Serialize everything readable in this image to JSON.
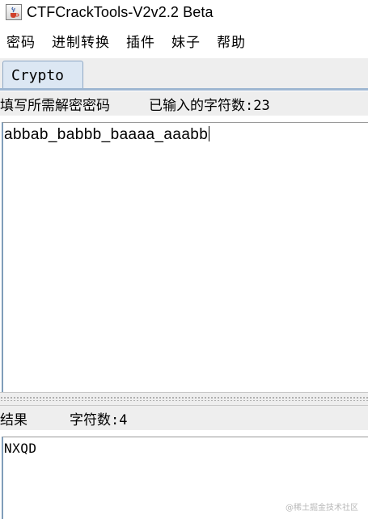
{
  "window": {
    "title": "CTFCrackTools-V2v2.2 Beta",
    "icon": "java-cup-icon"
  },
  "menu": {
    "items": [
      {
        "label": "密码"
      },
      {
        "label": "进制转换"
      },
      {
        "label": "插件"
      },
      {
        "label": "妹子"
      },
      {
        "label": "帮助"
      }
    ]
  },
  "tabs": [
    {
      "label": "Crypto",
      "active": true
    }
  ],
  "input": {
    "label": "填写所需解密密码",
    "count_label": "已输入的字符数:23",
    "value": "abbab_babbb_baaaa_aaabb"
  },
  "result": {
    "label": "结果",
    "count_label": "字符数:4",
    "value": "NXQD"
  },
  "watermark": "@稀土掘金技术社区",
  "colors": {
    "tab_bg": "#dce7f3",
    "tab_border": "#8fa8c4",
    "panel_bg": "#eeeeee",
    "text_area_bg": "#ffffff"
  }
}
